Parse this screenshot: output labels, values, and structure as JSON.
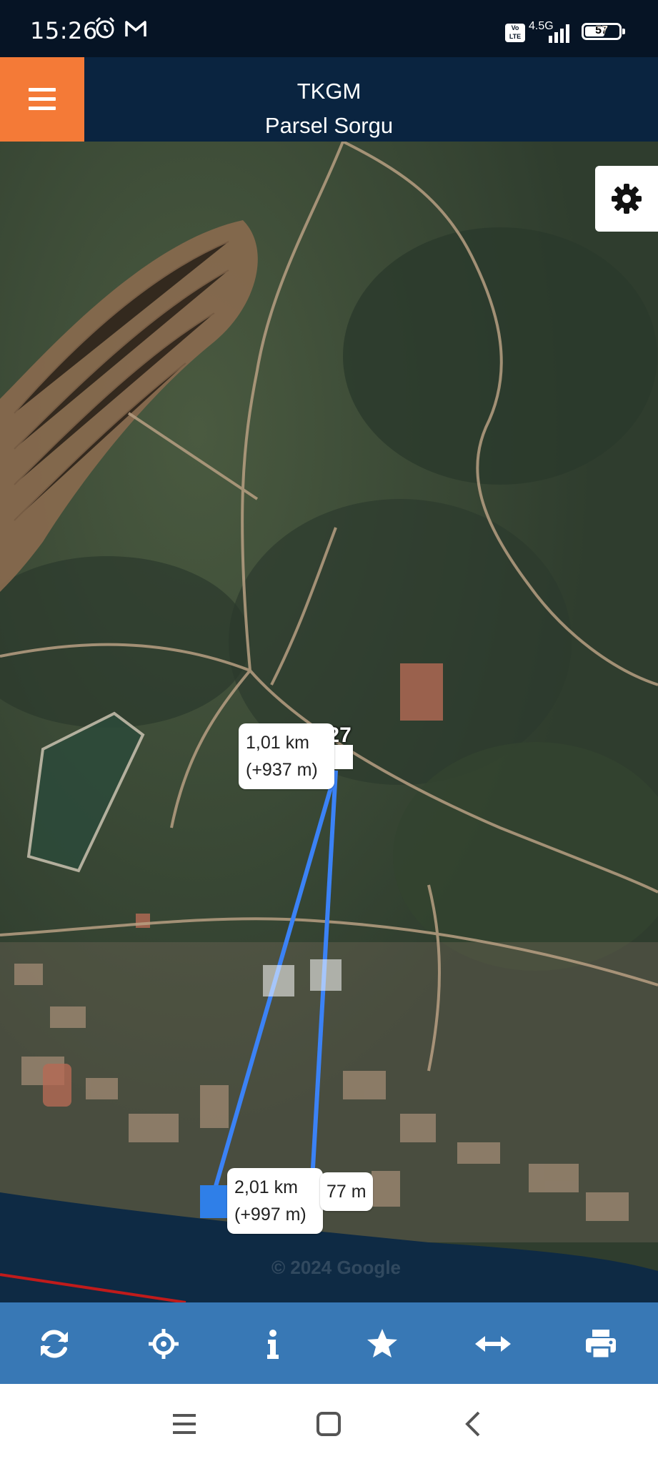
{
  "status_bar": {
    "time": "15:26",
    "icons": [
      "alarm-icon",
      "gmail-icon",
      "volte-icon",
      "signal-icon",
      "battery-icon"
    ],
    "network": "4.5G",
    "volte": "Vo LTE",
    "battery": "57"
  },
  "app_bar": {
    "title": "TKGM",
    "subtitle": "Parsel Sorgu",
    "menu_icon": "hamburger-icon",
    "accent_color": "#f47a37",
    "bar_color": "#0a2440"
  },
  "map": {
    "parcel_label": "774/27",
    "watermark": "© 2024 Google",
    "settings_icon": "gear-icon",
    "measure_line_color": "#3b82f6",
    "measurements": {
      "first_distance": "1,01 km",
      "first_delta": "(+937 m)",
      "second_distance": "2,01 km",
      "second_delta": "(+997 m)",
      "third_distance": "77 m"
    }
  },
  "toolbar": {
    "color": "#3878b5",
    "items": [
      {
        "name": "refresh",
        "icon": "refresh-icon"
      },
      {
        "name": "locate",
        "icon": "crosshair-icon"
      },
      {
        "name": "info",
        "icon": "info-icon"
      },
      {
        "name": "favorites",
        "icon": "star-icon"
      },
      {
        "name": "measure",
        "icon": "arrows-horizontal-icon"
      },
      {
        "name": "print",
        "icon": "print-icon"
      }
    ]
  },
  "nav_bar": {
    "items": [
      "menu-icon",
      "home-icon",
      "back-icon"
    ]
  }
}
